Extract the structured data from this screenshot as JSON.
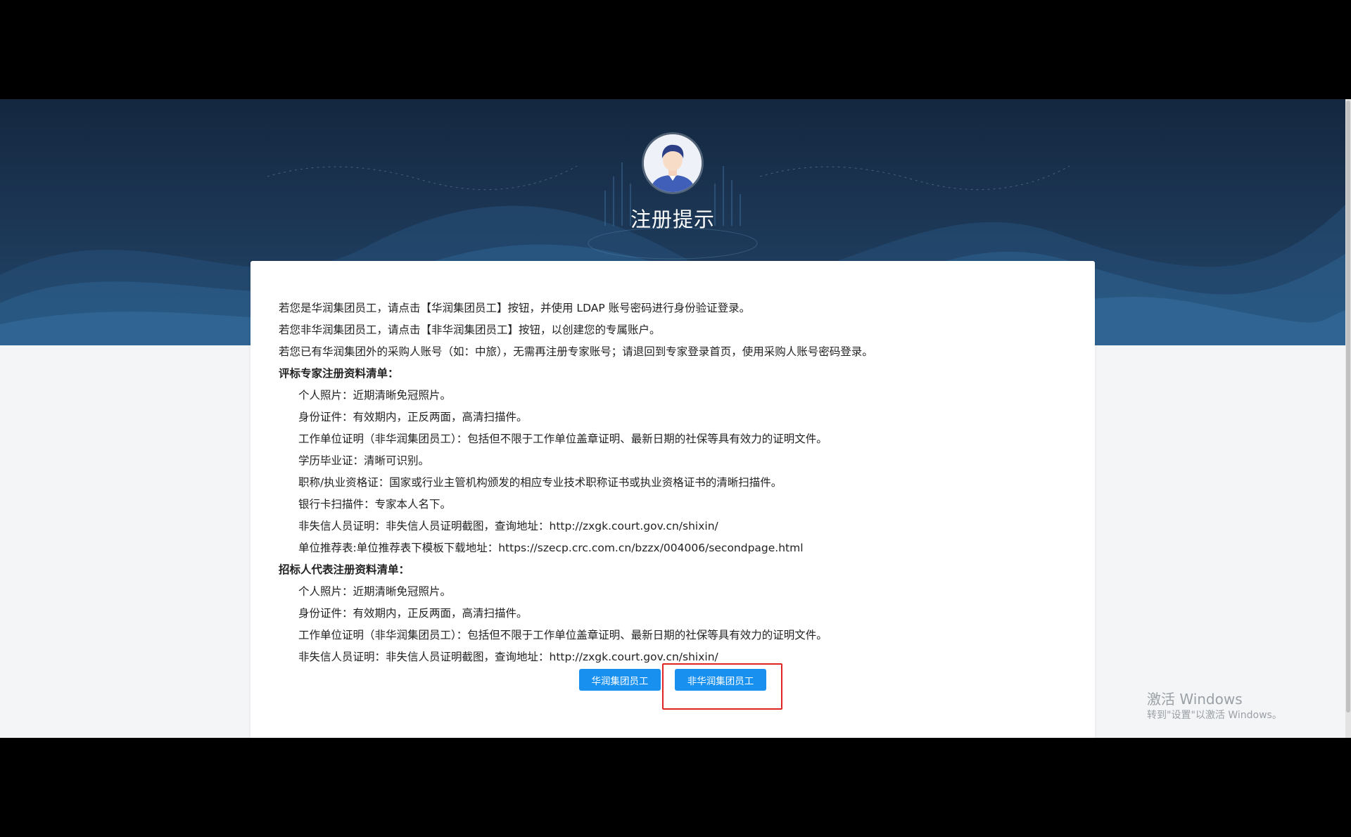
{
  "header": {
    "title": "注册提示"
  },
  "notice": {
    "lines": [
      "若您是华润集团员工，请点击【华润集团员工】按钮，并使用 LDAP 账号密码进行身份验证登录。",
      "若您非华润集团员工，请点击【非华润集团员工】按钮，以创建您的专属账户。",
      "若您已有华润集团外的采购人账号（如：中旅），无需再注册专家账号；请退回到专家登录首页，使用采购人账号密码登录。"
    ]
  },
  "expert_section": {
    "heading": "评标专家注册资料清单：",
    "items": [
      "个人照片：近期清晰免冠照片。",
      "身份证件：有效期内，正反两面，高清扫描件。",
      "工作单位证明（非华润集团员工）：包括但不限于工作单位盖章证明、最新日期的社保等具有效力的证明文件。",
      "学历毕业证：清晰可识别。",
      "职称/执业资格证：国家或行业主管机构颁发的相应专业技术职称证书或执业资格证书的清晰扫描件。",
      "银行卡扫描件：专家本人名下。",
      "非失信人员证明：非失信人员证明截图，查询地址：http://zxgk.court.gov.cn/shixin/",
      "单位推荐表:单位推荐表下模板下载地址：https://szecp.crc.com.cn/bzzx/004006/secondpage.html"
    ]
  },
  "tenderer_section": {
    "heading": "招标人代表注册资料清单：",
    "items": [
      "个人照片：近期清晰免冠照片。",
      "身份证件：有效期内，正反两面，高清扫描件。",
      "工作单位证明（非华润集团员工）：包括但不限于工作单位盖章证明、最新日期的社保等具有效力的证明文件。",
      "非失信人员证明：非失信人员证明截图，查询地址：http://zxgk.court.gov.cn/shixin/"
    ]
  },
  "buttons": {
    "crc_employee": "华润集团员工",
    "non_crc_employee": "非华润集团员工"
  },
  "watermark": {
    "title": "激活 Windows",
    "subtitle": "转到\"设置\"以激活 Windows。"
  },
  "colors": {
    "button": "#1890f0",
    "highlight_box": "#e02424",
    "banner": "#1b3553"
  },
  "icons": {
    "avatar": "user-avatar-icon"
  }
}
